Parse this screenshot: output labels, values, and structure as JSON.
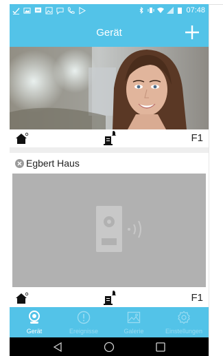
{
  "status_bar": {
    "time": "07:48"
  },
  "app_bar": {
    "title": "Gerät"
  },
  "devices": [
    {
      "floor_label": "F1"
    },
    {
      "name": "Egbert Haus",
      "floor_label": "F1"
    }
  ],
  "tabs": [
    {
      "label": "Gerät",
      "icon": "camera-icon",
      "active": true
    },
    {
      "label": "Ereignisse",
      "icon": "alert-icon",
      "active": false
    },
    {
      "label": "Galerie",
      "icon": "gallery-icon",
      "active": false
    },
    {
      "label": "Einstellungen",
      "icon": "gear-icon",
      "active": false
    }
  ],
  "colors": {
    "primary": "#53c3e8",
    "placeholder": "#b1b1b1"
  }
}
